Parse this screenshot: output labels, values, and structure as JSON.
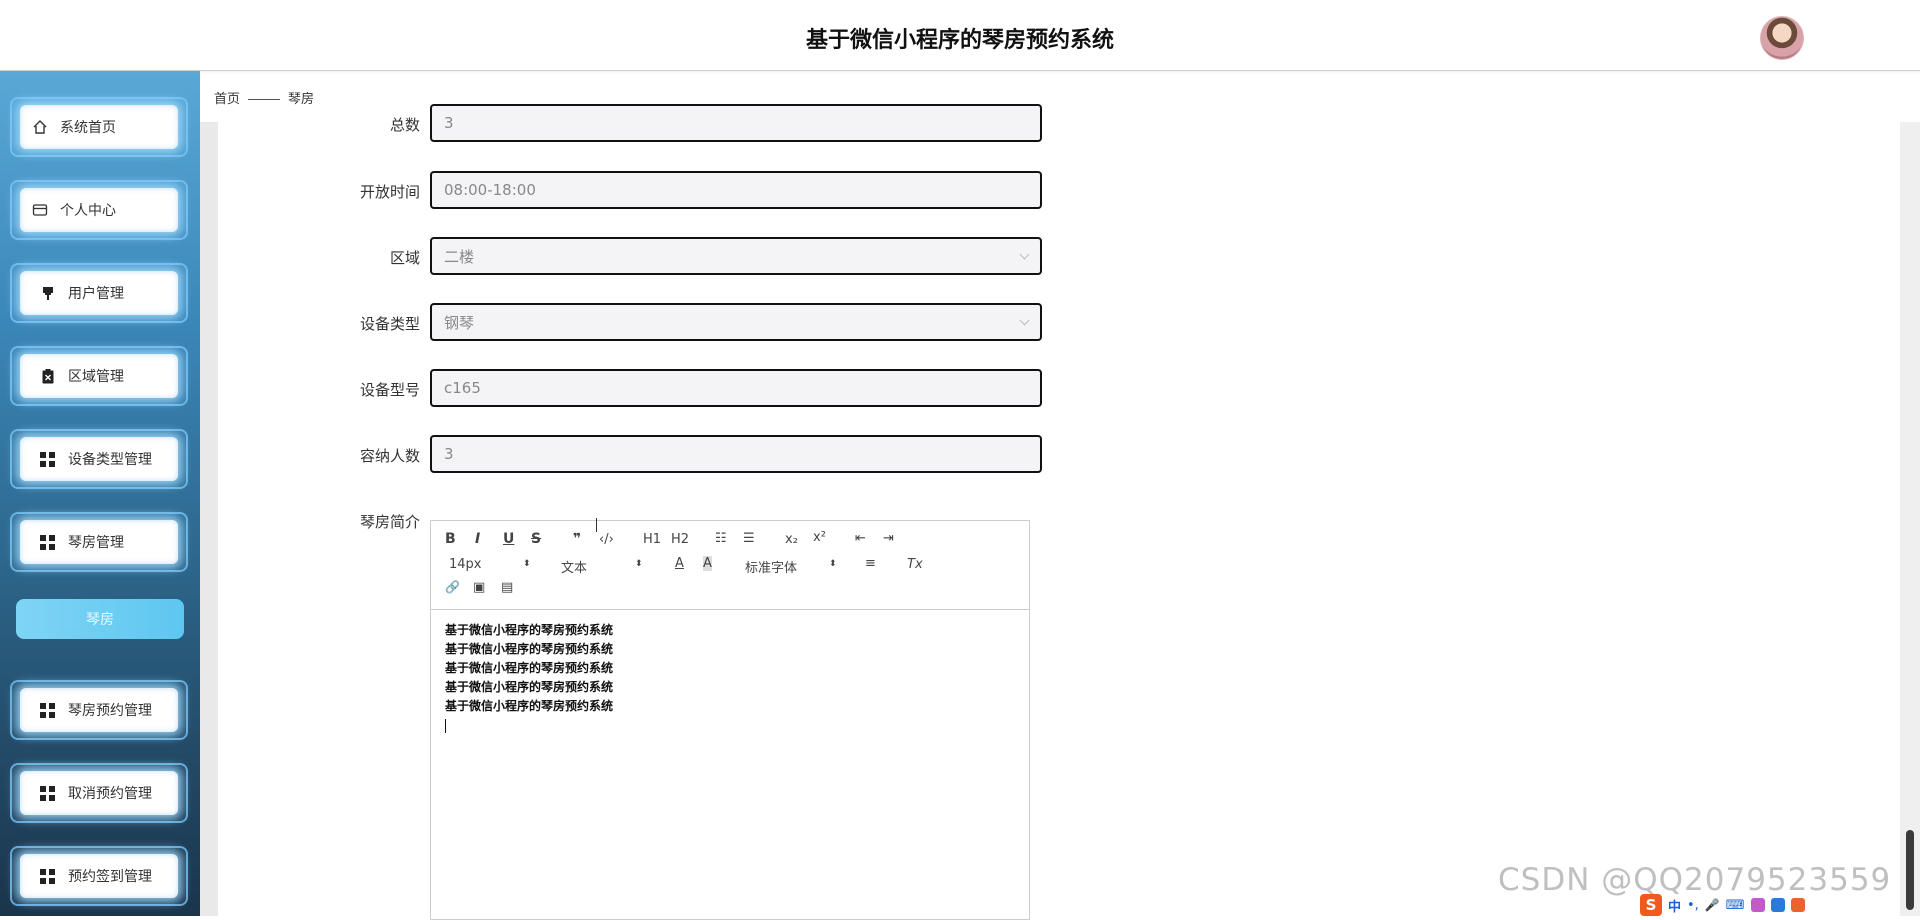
{
  "header": {
    "title": "基于微信小程序的琴房预约系统"
  },
  "breadcrumb": {
    "home": "首页",
    "current": "琴房"
  },
  "sidebar": {
    "items": [
      {
        "label": "系统首页",
        "icon": "home-icon"
      },
      {
        "label": "个人中心",
        "icon": "card-icon"
      },
      {
        "label": "用户管理",
        "icon": "pin-icon"
      },
      {
        "label": "区域管理",
        "icon": "clipboard-icon"
      },
      {
        "label": "设备类型管理",
        "icon": "grid-icon"
      },
      {
        "label": "琴房管理",
        "icon": "grid-icon"
      },
      {
        "label": "琴房预约管理",
        "icon": "grid-icon"
      },
      {
        "label": "取消预约管理",
        "icon": "grid-icon"
      },
      {
        "label": "预约签到管理",
        "icon": "grid-icon"
      }
    ],
    "sub_item": "琴房"
  },
  "form": {
    "total": {
      "label": "总数",
      "value": "3"
    },
    "open_time": {
      "label": "开放时间",
      "value": "08:00-18:00"
    },
    "area": {
      "label": "区域",
      "value": "二楼"
    },
    "device_type": {
      "label": "设备类型",
      "value": "钢琴"
    },
    "device_model": {
      "label": "设备型号",
      "value": "c165"
    },
    "capacity": {
      "label": "容纳人数",
      "value": "3"
    },
    "intro": {
      "label": "琴房简介",
      "lines": [
        "基于微信小程序的琴房预约系统",
        "基于微信小程序的琴房预约系统",
        "基于微信小程序的琴房预约系统",
        "基于微信小程序的琴房预约系统",
        "基于微信小程序的琴房预约系统"
      ]
    }
  },
  "editor_toolbar": {
    "bold": "B",
    "italic": "I",
    "underline": "U",
    "strike": "S",
    "quote": "❞",
    "code": "‹/›",
    "h1": "H1",
    "h2": "H2",
    "ordered_list": "☷",
    "bullet_list": "☰",
    "subscript": "x₂",
    "superscript": "x²",
    "outdent": "⇤",
    "indent": "⇥",
    "font_size": "14px",
    "header_select": "文本",
    "color": "A",
    "background": "A",
    "font_family": "标准字体",
    "align": "≡",
    "clean": "Tx",
    "link": "🔗",
    "image": "▣",
    "video": "▤"
  },
  "watermark": "CSDN @QQ2079523559",
  "ime": {
    "lang": "中",
    "punct": "•,",
    "mic": "🎤",
    "keyboard": "⌨"
  }
}
